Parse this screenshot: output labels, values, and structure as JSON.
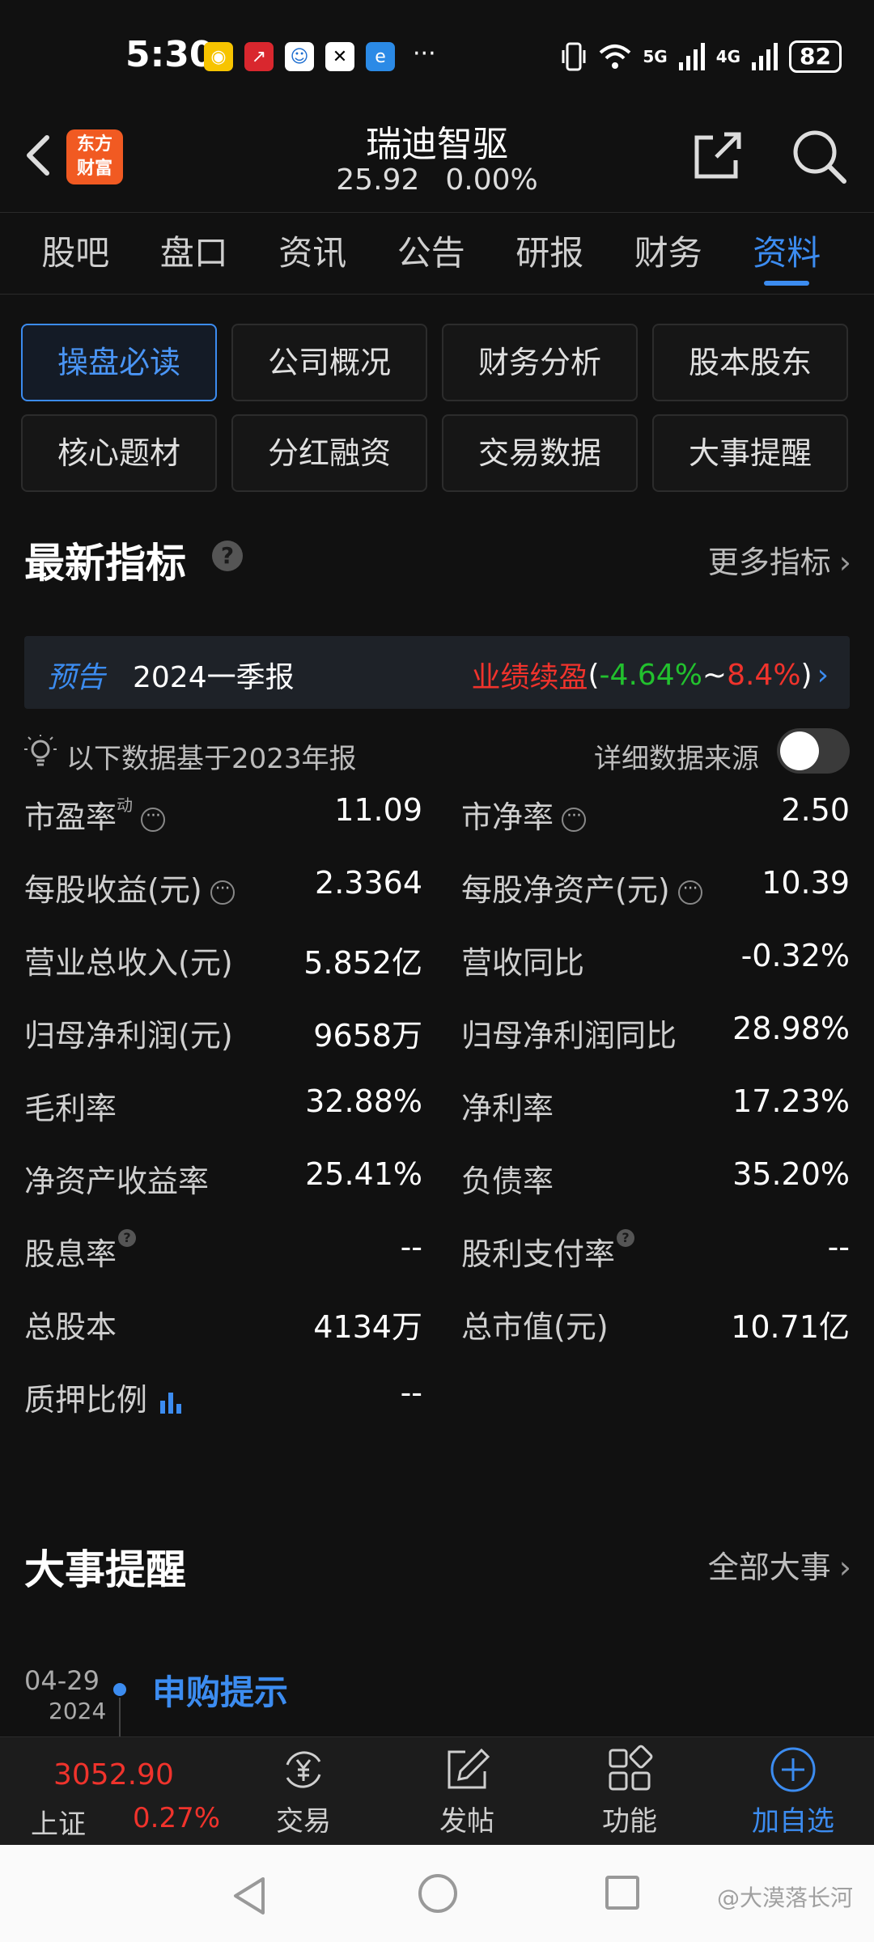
{
  "status_bar": {
    "time": "5:30",
    "network_5g": "5G",
    "network_4g": "4G",
    "battery": "82"
  },
  "header": {
    "logo_text": "东方财富",
    "stock_name": "瑞迪智驱",
    "price": "25.92",
    "change_pct": "0.00%"
  },
  "tabs": [
    "股吧",
    "盘口",
    "资讯",
    "公告",
    "研报",
    "财务",
    "资料"
  ],
  "active_tab": "资料",
  "sub_buttons": [
    "操盘必读",
    "公司概况",
    "财务分析",
    "股本股东",
    "核心题材",
    "分红融资",
    "交易数据",
    "大事提醒"
  ],
  "latest": {
    "title": "最新指标",
    "more": "更多指标",
    "forecast": {
      "tag": "预告",
      "period": "2024一季报",
      "type": "业绩续盈",
      "low": "-4.64%",
      "tilde": "~",
      "high": "8.4%",
      "open": "(",
      "close": ")"
    },
    "basis": "以下数据基于2023年报",
    "source_label": "详细数据来源",
    "metrics": [
      {
        "l_label": "市盈率",
        "l_sup": "动",
        "l_value": "11.09",
        "r_label": "市净率",
        "r_value": "2.50"
      },
      {
        "l_label": "每股收益(元)",
        "l_value": "2.3364",
        "r_label": "每股净资产(元)",
        "r_value": "10.39"
      },
      {
        "l_label": "营业总收入(元)",
        "l_value": "5.852亿",
        "r_label": "营收同比",
        "r_value": "-0.32%"
      },
      {
        "l_label": "归母净利润(元)",
        "l_value": "9658万",
        "r_label": "归母净利润同比",
        "r_value": "28.98%"
      },
      {
        "l_label": "毛利率",
        "l_value": "32.88%",
        "r_label": "净利率",
        "r_value": "17.23%"
      },
      {
        "l_label": "净资产收益率",
        "l_value": "25.41%",
        "r_label": "负债率",
        "r_value": "35.20%"
      },
      {
        "l_label": "股息率",
        "l_value": "--",
        "r_label": "股利支付率",
        "r_value": "--"
      },
      {
        "l_label": "总股本",
        "l_value": "4134万",
        "r_label": "总市值(元)",
        "r_value": "10.71亿"
      },
      {
        "l_label": "质押比例",
        "l_value": "--"
      }
    ]
  },
  "events": {
    "title": "大事提醒",
    "more": "全部大事",
    "item": {
      "date": "04-29",
      "year": "2024",
      "title": "申购提示"
    }
  },
  "bottom_nav": {
    "index_value": "3052.90",
    "index_name": "上证",
    "index_change": "0.27%",
    "items": [
      "交易",
      "发帖",
      "功能",
      "加自选"
    ]
  },
  "watermark": "@大漠落长河",
  "colors": {
    "accent": "#3c8cf0",
    "up": "#f0332c",
    "down": "#22c12e",
    "background": "#111111"
  }
}
